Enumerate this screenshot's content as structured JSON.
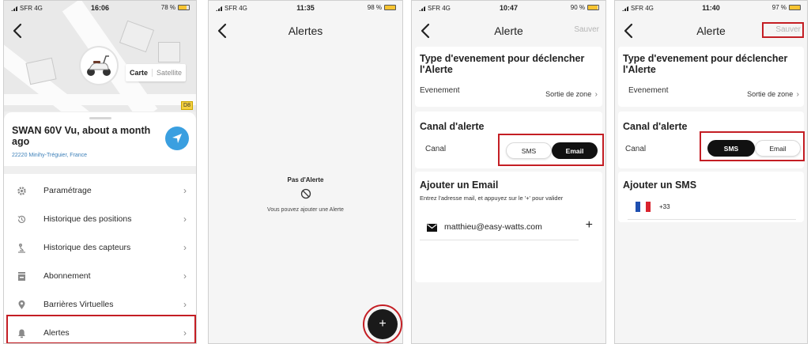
{
  "colors": {
    "accent": "#c41e24",
    "toggle_active": "#111111",
    "nav_button": "#3a9fe0",
    "battery": "#f7c431",
    "address": "#3b7fb8"
  },
  "screen1": {
    "status": {
      "carrier": "SFR 4G",
      "time": "16:06",
      "battery": "78 %",
      "battery_level": 0.78
    },
    "map": {
      "carte_label": "Carte",
      "satellite_label": "Satellite",
      "route_badge": "D8",
      "marker_icon": "scooter-icon"
    },
    "device": {
      "title": "SWAN 60V Vu, about a month ago",
      "address": "22220 Minihy-Tréguier, France",
      "nav_icon": "navigation-arrow-icon"
    },
    "menu": [
      {
        "label": "Paramétrage",
        "icon": "gear-icon"
      },
      {
        "label": "Historique des positions",
        "icon": "history-icon"
      },
      {
        "label": "Historique des capteurs",
        "icon": "sensor-icon"
      },
      {
        "label": "Abonnement",
        "icon": "subscription-icon"
      },
      {
        "label": "Barrières Virtuelles",
        "icon": "location-pin-icon"
      },
      {
        "label": "Alertes",
        "icon": "bell-icon"
      }
    ]
  },
  "screen2": {
    "status": {
      "carrier": "SFR 4G",
      "time": "11:35",
      "battery": "98 %",
      "battery_level": 0.98
    },
    "title": "Alertes",
    "empty_title": "Pas d'Alerte",
    "empty_message": "Vous pouvez ajouter une Alerte",
    "fab_label": "+"
  },
  "screen3": {
    "status": {
      "carrier": "SFR 4G",
      "time": "10:47",
      "battery": "90 %",
      "battery_level": 0.9
    },
    "title": "Alerte",
    "save_label": "Sauver",
    "event_section_title": "Type d'evenement pour déclencher l'Alerte",
    "event_label": "Evenement",
    "event_value": "Sortie de zone",
    "channel_section_title": "Canal d'alerte",
    "channel_label": "Canal",
    "options": [
      "SMS",
      "Email"
    ],
    "selected": "Email",
    "add_title": "Ajouter un Email",
    "add_hint": "Entrez l'adresse mail, et appuyez sur le '+' pour valider",
    "email_value": "matthieu@easy-watts.com",
    "add_button": "+"
  },
  "screen4": {
    "status": {
      "carrier": "SFR 4G",
      "time": "11:40",
      "battery": "97 %",
      "battery_level": 0.97
    },
    "title": "Alerte",
    "save_label": "Sauver",
    "event_section_title": "Type d'evenement pour déclencher l'Alerte",
    "event_label": "Evenement",
    "event_value": "Sortie de zone",
    "channel_section_title": "Canal d'alerte",
    "channel_label": "Canal",
    "options": [
      "SMS",
      "Email"
    ],
    "selected": "SMS",
    "add_title": "Ajouter un SMS",
    "phone_prefix": "+33",
    "flag": "france-flag-icon"
  }
}
